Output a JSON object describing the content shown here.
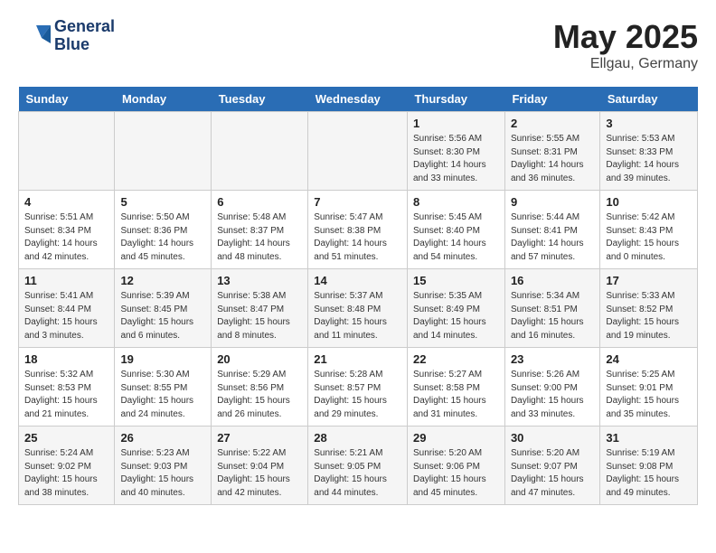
{
  "header": {
    "logo_line1": "General",
    "logo_line2": "Blue",
    "month_year": "May 2025",
    "location": "Ellgau, Germany"
  },
  "weekdays": [
    "Sunday",
    "Monday",
    "Tuesday",
    "Wednesday",
    "Thursday",
    "Friday",
    "Saturday"
  ],
  "weeks": [
    [
      {
        "day": "",
        "info": ""
      },
      {
        "day": "",
        "info": ""
      },
      {
        "day": "",
        "info": ""
      },
      {
        "day": "",
        "info": ""
      },
      {
        "day": "1",
        "info": "Sunrise: 5:56 AM\nSunset: 8:30 PM\nDaylight: 14 hours\nand 33 minutes."
      },
      {
        "day": "2",
        "info": "Sunrise: 5:55 AM\nSunset: 8:31 PM\nDaylight: 14 hours\nand 36 minutes."
      },
      {
        "day": "3",
        "info": "Sunrise: 5:53 AM\nSunset: 8:33 PM\nDaylight: 14 hours\nand 39 minutes."
      }
    ],
    [
      {
        "day": "4",
        "info": "Sunrise: 5:51 AM\nSunset: 8:34 PM\nDaylight: 14 hours\nand 42 minutes."
      },
      {
        "day": "5",
        "info": "Sunrise: 5:50 AM\nSunset: 8:36 PM\nDaylight: 14 hours\nand 45 minutes."
      },
      {
        "day": "6",
        "info": "Sunrise: 5:48 AM\nSunset: 8:37 PM\nDaylight: 14 hours\nand 48 minutes."
      },
      {
        "day": "7",
        "info": "Sunrise: 5:47 AM\nSunset: 8:38 PM\nDaylight: 14 hours\nand 51 minutes."
      },
      {
        "day": "8",
        "info": "Sunrise: 5:45 AM\nSunset: 8:40 PM\nDaylight: 14 hours\nand 54 minutes."
      },
      {
        "day": "9",
        "info": "Sunrise: 5:44 AM\nSunset: 8:41 PM\nDaylight: 14 hours\nand 57 minutes."
      },
      {
        "day": "10",
        "info": "Sunrise: 5:42 AM\nSunset: 8:43 PM\nDaylight: 15 hours\nand 0 minutes."
      }
    ],
    [
      {
        "day": "11",
        "info": "Sunrise: 5:41 AM\nSunset: 8:44 PM\nDaylight: 15 hours\nand 3 minutes."
      },
      {
        "day": "12",
        "info": "Sunrise: 5:39 AM\nSunset: 8:45 PM\nDaylight: 15 hours\nand 6 minutes."
      },
      {
        "day": "13",
        "info": "Sunrise: 5:38 AM\nSunset: 8:47 PM\nDaylight: 15 hours\nand 8 minutes."
      },
      {
        "day": "14",
        "info": "Sunrise: 5:37 AM\nSunset: 8:48 PM\nDaylight: 15 hours\nand 11 minutes."
      },
      {
        "day": "15",
        "info": "Sunrise: 5:35 AM\nSunset: 8:49 PM\nDaylight: 15 hours\nand 14 minutes."
      },
      {
        "day": "16",
        "info": "Sunrise: 5:34 AM\nSunset: 8:51 PM\nDaylight: 15 hours\nand 16 minutes."
      },
      {
        "day": "17",
        "info": "Sunrise: 5:33 AM\nSunset: 8:52 PM\nDaylight: 15 hours\nand 19 minutes."
      }
    ],
    [
      {
        "day": "18",
        "info": "Sunrise: 5:32 AM\nSunset: 8:53 PM\nDaylight: 15 hours\nand 21 minutes."
      },
      {
        "day": "19",
        "info": "Sunrise: 5:30 AM\nSunset: 8:55 PM\nDaylight: 15 hours\nand 24 minutes."
      },
      {
        "day": "20",
        "info": "Sunrise: 5:29 AM\nSunset: 8:56 PM\nDaylight: 15 hours\nand 26 minutes."
      },
      {
        "day": "21",
        "info": "Sunrise: 5:28 AM\nSunset: 8:57 PM\nDaylight: 15 hours\nand 29 minutes."
      },
      {
        "day": "22",
        "info": "Sunrise: 5:27 AM\nSunset: 8:58 PM\nDaylight: 15 hours\nand 31 minutes."
      },
      {
        "day": "23",
        "info": "Sunrise: 5:26 AM\nSunset: 9:00 PM\nDaylight: 15 hours\nand 33 minutes."
      },
      {
        "day": "24",
        "info": "Sunrise: 5:25 AM\nSunset: 9:01 PM\nDaylight: 15 hours\nand 35 minutes."
      }
    ],
    [
      {
        "day": "25",
        "info": "Sunrise: 5:24 AM\nSunset: 9:02 PM\nDaylight: 15 hours\nand 38 minutes."
      },
      {
        "day": "26",
        "info": "Sunrise: 5:23 AM\nSunset: 9:03 PM\nDaylight: 15 hours\nand 40 minutes."
      },
      {
        "day": "27",
        "info": "Sunrise: 5:22 AM\nSunset: 9:04 PM\nDaylight: 15 hours\nand 42 minutes."
      },
      {
        "day": "28",
        "info": "Sunrise: 5:21 AM\nSunset: 9:05 PM\nDaylight: 15 hours\nand 44 minutes."
      },
      {
        "day": "29",
        "info": "Sunrise: 5:20 AM\nSunset: 9:06 PM\nDaylight: 15 hours\nand 45 minutes."
      },
      {
        "day": "30",
        "info": "Sunrise: 5:20 AM\nSunset: 9:07 PM\nDaylight: 15 hours\nand 47 minutes."
      },
      {
        "day": "31",
        "info": "Sunrise: 5:19 AM\nSunset: 9:08 PM\nDaylight: 15 hours\nand 49 minutes."
      }
    ]
  ]
}
